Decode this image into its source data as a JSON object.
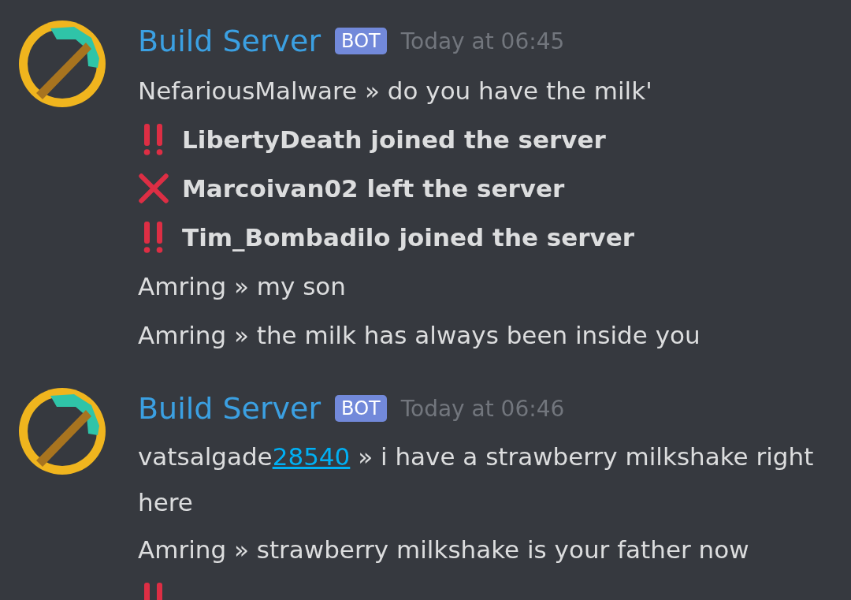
{
  "messages": [
    {
      "author": "Build Server",
      "badge": "BOT",
      "timestamp": "Today at 06:45",
      "lines": [
        {
          "kind": "chat",
          "text": "NefariousMalware » do you have the milk'"
        },
        {
          "kind": "join",
          "text": "LibertyDeath joined the server"
        },
        {
          "kind": "leave",
          "text": "Marcoivan02 left the server"
        },
        {
          "kind": "join",
          "text": "Tim_Bombadilo joined the server"
        },
        {
          "kind": "chat",
          "text": "Amring » my son"
        },
        {
          "kind": "chat",
          "text": "Amring » the milk has always been inside you"
        }
      ]
    },
    {
      "author": "Build Server",
      "badge": "BOT",
      "timestamp": "Today at 06:46",
      "lines": [
        {
          "kind": "chat",
          "text": "vatsalgade",
          "link": "28540",
          "after": " » i have a strawberry milkshake right here"
        },
        {
          "kind": "chat",
          "text": "Amring » strawberry milkshake is your father now"
        },
        {
          "kind": "join"
        }
      ]
    }
  ]
}
